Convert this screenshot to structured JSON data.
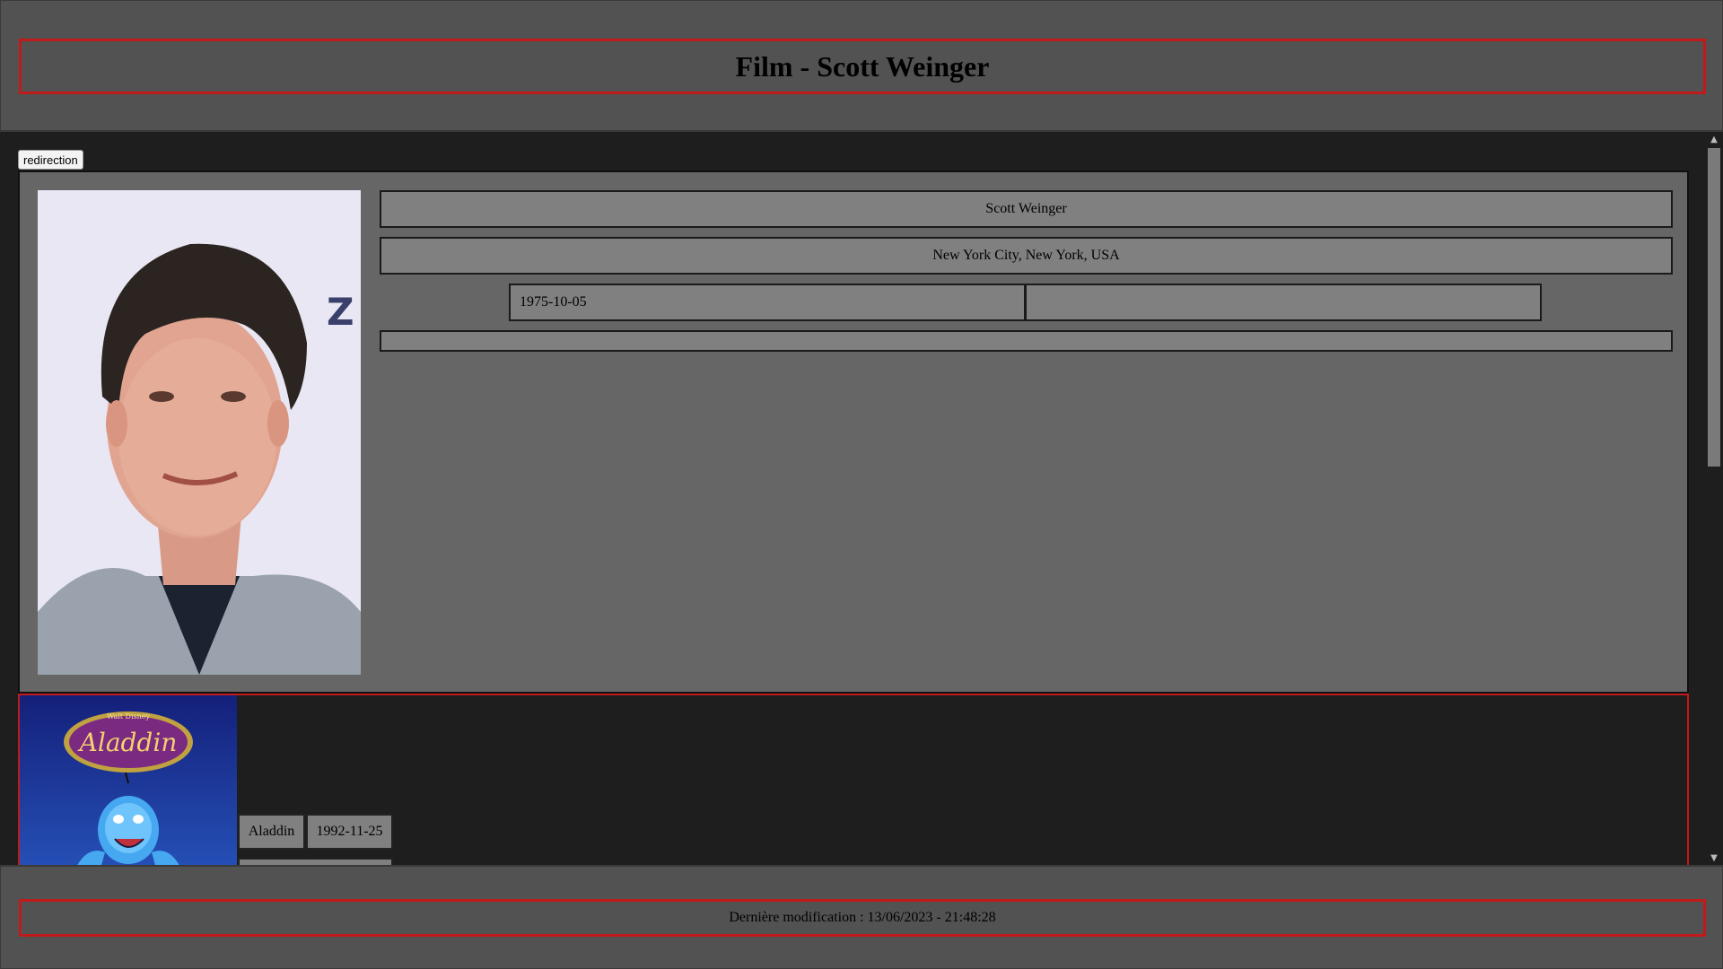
{
  "header": {
    "title": "Film - Scott Weinger"
  },
  "main": {
    "redirect_label": "redirection",
    "person": {
      "name": "Scott Weinger",
      "birthplace": "New York City, New York, USA",
      "birth_date": "1975-10-05",
      "death_date": "",
      "bio": ""
    },
    "films": [
      {
        "title": "Aladdin",
        "release_date": "1992-11-25",
        "poster_text": "Aladdin",
        "poster_brand": "Walt Disney"
      }
    ]
  },
  "footer": {
    "last_modified": "Dernière modification : 13/06/2023 - 21:48:28"
  },
  "colors": {
    "accent_border": "#c01a1a",
    "header_bg": "#525252",
    "card_bg": "#666666",
    "field_bg": "#808080",
    "page_bg": "#1e1e1e"
  },
  "icons": {
    "scroll_up": "chevron-up-icon",
    "scroll_down": "chevron-down-icon"
  }
}
